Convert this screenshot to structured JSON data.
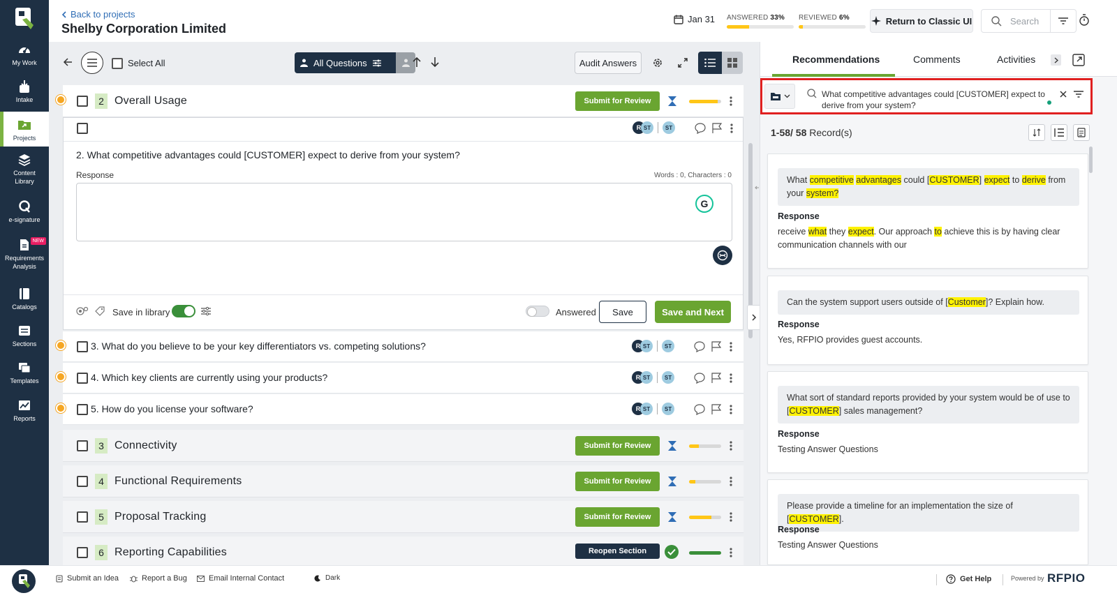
{
  "nav": {
    "items": [
      {
        "label": "My Work",
        "icon": "dashboard-icon"
      },
      {
        "label": "Intake",
        "icon": "intake-icon"
      },
      {
        "label": "Projects",
        "icon": "projects-icon"
      },
      {
        "label": "Content Library",
        "icon": "content-library-icon"
      },
      {
        "label": "e-signature",
        "icon": "e-signature-icon"
      },
      {
        "label": "Requirements Analysis",
        "icon": "requirements-icon",
        "badge": "NEW"
      },
      {
        "label": "Catalogs",
        "icon": "catalogs-icon"
      },
      {
        "label": "Sections",
        "icon": "sections-icon"
      },
      {
        "label": "Templates",
        "icon": "templates-icon"
      },
      {
        "label": "Reports",
        "icon": "reports-icon"
      }
    ],
    "active": "Projects"
  },
  "header": {
    "back_label": "Back to projects",
    "project_title": "Shelby Corporation Limited",
    "date": "Jan 31",
    "answered_label": "ANSWERED",
    "answered_pct": "33%",
    "answered_value": 33,
    "reviewed_label": "REVIEWED",
    "reviewed_pct": "6%",
    "reviewed_value": 6,
    "classic_btn": "Return to Classic UI",
    "search_placeholder": "Search"
  },
  "toolbar": {
    "select_all": "Select All",
    "all_questions": "All Questions",
    "audit_answers": "Audit Answers"
  },
  "sections": [
    {
      "num": "2",
      "title": "Overall Usage",
      "action": "Submit for Review",
      "progress": 0.9
    },
    {
      "num": "3",
      "title": "Connectivity",
      "action": "Submit for Review",
      "progress": 0.3
    },
    {
      "num": "4",
      "title": "Functional Requirements",
      "action": "Submit for Review",
      "progress": 0.2
    },
    {
      "num": "5",
      "title": "Proposal Tracking",
      "action": "Submit for Review",
      "progress": 0.7
    },
    {
      "num": "6",
      "title": "Reporting Capabilities",
      "action": "Reopen Section",
      "progress": 1.0
    }
  ],
  "active_question": {
    "text": "2. What competitive advantages could [CUSTOMER] expect to derive from your system?",
    "response_label": "Response",
    "counter": "Words : 0, Characters : 0",
    "grammarly": "G",
    "save_in_library": "Save in library",
    "answered_label": "Answered",
    "save_btn": "Save",
    "save_next_btn": "Save and Next"
  },
  "questions": [
    {
      "text": "3. What do you believe to be your key differentiators vs. competing solutions?"
    },
    {
      "text": "4. Which key clients are currently using your products?"
    },
    {
      "text": "5. How do you license your software?"
    }
  ],
  "avatars": {
    "r": "R",
    "st": "ST"
  },
  "right_panel": {
    "tabs": [
      "Recommendations",
      "Comments",
      "Activities"
    ],
    "active_tab": "Recommendations",
    "query": "What competitive advantages could [CUSTOMER] expect to derive from your system?",
    "record_count_range": "1-58/ 58",
    "record_count_label": "Record(s)",
    "response_label": "Response",
    "records": [
      {
        "answer": "receive what they expect. Our approach to achieve this is by having clear communication channels with our"
      },
      {
        "answer": "Yes, RFPIO provides guest accounts."
      },
      {
        "answer": "Testing Answer Questions"
      },
      {
        "answer": "Testing Answer Questions"
      }
    ]
  },
  "footer": {
    "submit_idea": "Submit an Idea",
    "report_bug": "Report a Bug",
    "email_contact": "Email Internal Contact",
    "dark": "Dark",
    "get_help": "Get Help",
    "powered_by": "Powered by",
    "brand": "RFPIO"
  },
  "colors": {
    "nav_bg": "#1e3044",
    "accent_green": "#6aa531",
    "progress_yellow": "#ffc617",
    "highlight": "#fff200",
    "focus_red": "#e02020"
  }
}
